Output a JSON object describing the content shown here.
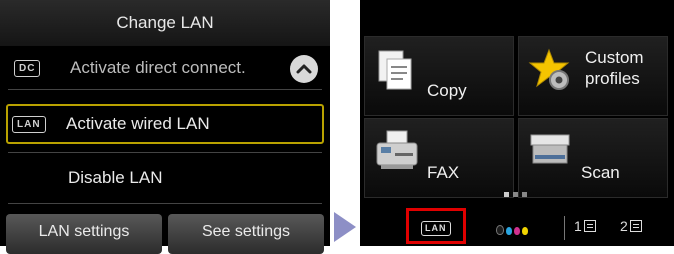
{
  "left_screen": {
    "title": "Change LAN",
    "items": [
      {
        "tag": "DC",
        "label": "Activate direct connect."
      },
      {
        "tag": "LAN",
        "label": "Activate wired LAN",
        "selected": true
      },
      {
        "tag": "",
        "label": "Disable LAN"
      }
    ],
    "buttons": {
      "lan_settings": "LAN settings",
      "see_settings": "See settings"
    },
    "colors": {
      "selection_border": "#b9a200"
    }
  },
  "right_screen": {
    "tiles": [
      {
        "label": "Copy",
        "icon": "copy-icon"
      },
      {
        "label": "Custom profiles",
        "icon": "custom-profiles-star-icon"
      },
      {
        "label": "FAX",
        "icon": "fax-icon"
      },
      {
        "label": "Scan",
        "icon": "scan-icon"
      }
    ],
    "status": {
      "lan_tag": "LAN",
      "tray1": "1",
      "tray2": "2",
      "highlight_color": "#e00000"
    }
  }
}
